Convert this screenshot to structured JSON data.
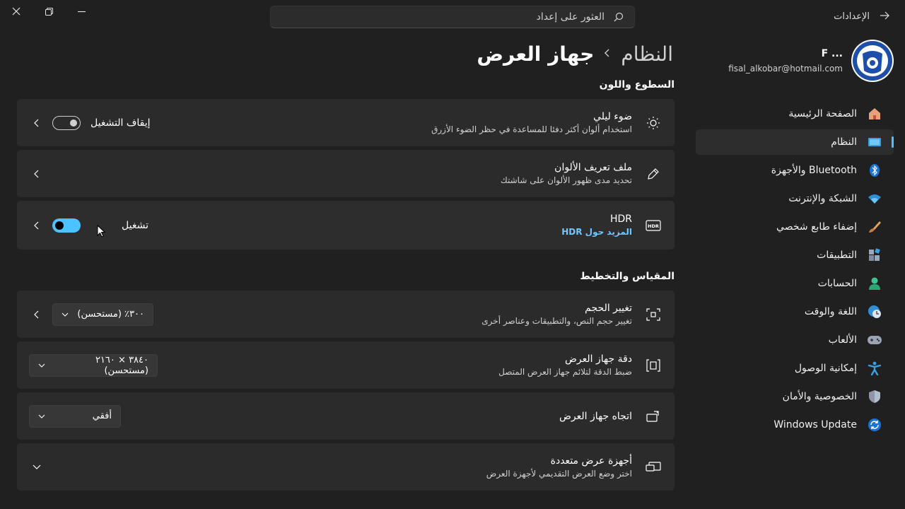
{
  "window": {
    "app_title": "الإعدادات"
  },
  "search": {
    "placeholder": "العثور على إعداد"
  },
  "profile": {
    "name": "F ...",
    "email": "fisal_alkobar@hotmail.com"
  },
  "sidebar": {
    "items": [
      {
        "label": "الصفحة الرئيسية",
        "icon": "home-icon",
        "active": false
      },
      {
        "label": "النظام",
        "icon": "system-icon",
        "active": true
      },
      {
        "label": "Bluetooth والأجهزة",
        "icon": "bluetooth-icon",
        "active": false
      },
      {
        "label": "الشبكة والإنترنت",
        "icon": "wifi-icon",
        "active": false
      },
      {
        "label": "إضفاء طابع شخصي",
        "icon": "brush-icon",
        "active": false
      },
      {
        "label": "التطبيقات",
        "icon": "apps-icon",
        "active": false
      },
      {
        "label": "الحسابات",
        "icon": "account-icon",
        "active": false
      },
      {
        "label": "اللغة والوقت",
        "icon": "globe-clock-icon",
        "active": false
      },
      {
        "label": "الألعاب",
        "icon": "gamepad-icon",
        "active": false
      },
      {
        "label": "إمكانية الوصول",
        "icon": "accessibility-icon",
        "active": false
      },
      {
        "label": "الخصوصية والأمان",
        "icon": "shield-icon",
        "active": false
      },
      {
        "label": "Windows Update",
        "icon": "update-icon",
        "active": false
      }
    ]
  },
  "breadcrumb": {
    "parent": "النظام",
    "current": "جهاز العرض"
  },
  "sections": {
    "brightness": "السطوع واللون",
    "scale": "المقياس والتخطيط"
  },
  "cards": {
    "night_light": {
      "title": "ضوء ليلي",
      "subtitle": "استخدام ألوان أكثر دفئا للمساعدة في حظر الضوء الأزرق",
      "state_label": "إيقاف التشغيل",
      "state": "off"
    },
    "color_profile": {
      "title": "ملف تعريف الألوان",
      "subtitle": "تحديد مدى ظهور الألوان على شاشتك"
    },
    "hdr": {
      "title": "HDR",
      "subtitle": "المزيد حول HDR",
      "state_label": "تشغيل",
      "state": "on",
      "icon_text": "HDR"
    },
    "scale": {
      "title": "تغيير الحجم",
      "subtitle": "تغيير حجم النص، والتطبيقات وعناصر أخرى",
      "value": "٣٠٠٪ (مستحسن)"
    },
    "resolution": {
      "title": "دقة جهاز العرض",
      "subtitle": "ضبط  الدقة لتلائم جهاز العرض المتصل",
      "value": "٣٨٤٠ × ٢١٦٠ (مستحسن)"
    },
    "orientation": {
      "title": "اتجاه جهاز العرض",
      "value": "أفقي"
    },
    "multiple": {
      "title": "أجهزة عرض متعددة",
      "subtitle": "اختر وضع العرض التقديمي لأجهزة العرض"
    }
  },
  "colors": {
    "accent": "#4cc2ff",
    "background": "#202020",
    "card": "#2b2b2b"
  }
}
